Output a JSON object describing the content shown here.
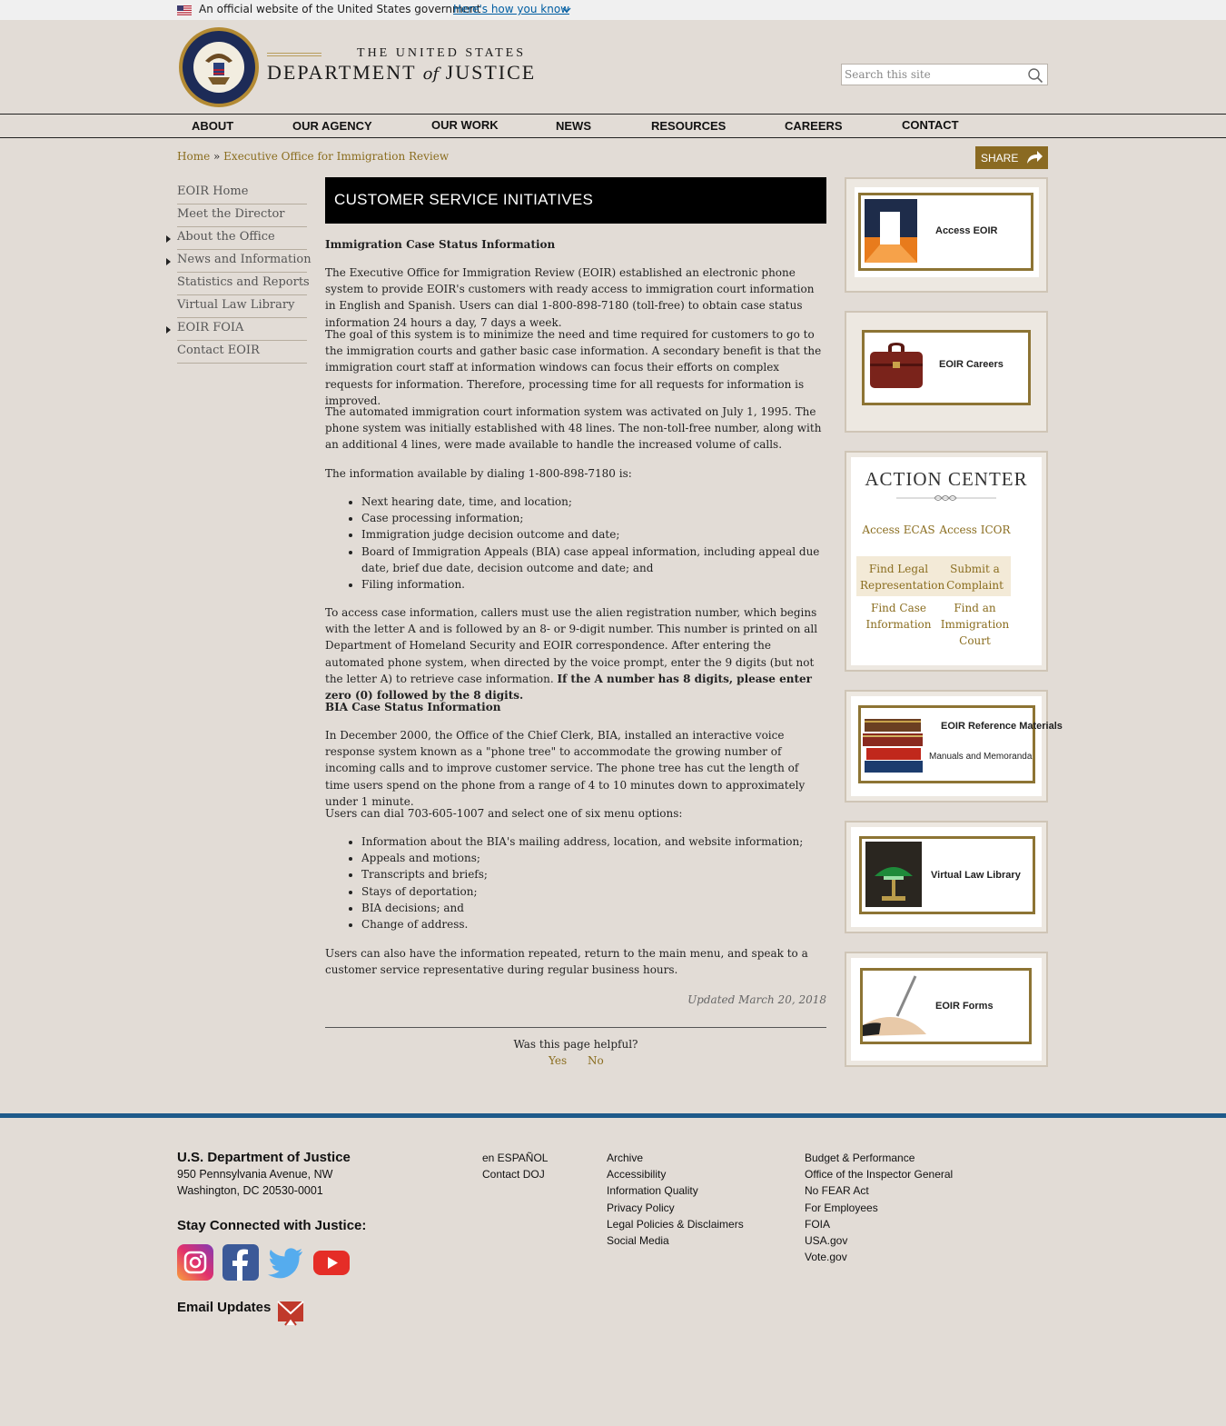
{
  "gov_banner": {
    "official_text": "An official website of the United States government",
    "how_you_know": "Here's how you know"
  },
  "header": {
    "title_line1": "THE UNITED STATES",
    "title_line2a": "DEPARTMENT",
    "title_line2b": "of",
    "title_line2c": "JUSTICE",
    "search_placeholder": "Search this site"
  },
  "nav": [
    "ABOUT",
    "OUR AGENCY",
    "OUR WORK",
    "NEWS",
    "RESOURCES",
    "CAREERS",
    "CONTACT"
  ],
  "breadcrumb": {
    "home": "Home",
    "sep": "»",
    "current": "Executive Office for Immigration Review"
  },
  "share_label": "SHARE",
  "left_nav": [
    {
      "label": "EOIR Home",
      "expandable": false
    },
    {
      "label": "Meet the Director",
      "expandable": false
    },
    {
      "label": "About the Office",
      "expandable": true
    },
    {
      "label": "News and Information",
      "expandable": true
    },
    {
      "label": "Statistics and Reports",
      "expandable": false
    },
    {
      "label": "Virtual Law Library",
      "expandable": false
    },
    {
      "label": "EOIR FOIA",
      "expandable": true
    },
    {
      "label": "Contact EOIR",
      "expandable": false
    }
  ],
  "main": {
    "heading": "CUSTOMER SERVICE INITIATIVES",
    "section1_title": "Immigration Case Status Information",
    "p1": "The Executive Office for Immigration Review (EOIR) established an electronic phone system to provide EOIR's customers with ready access to immigration court information in English and Spanish. Users can dial 1-800-898-7180 (toll-free) to obtain case status information 24 hours a day, 7 days a week.",
    "p2": "The goal of this system is to minimize the need and time required for customers to go to the immigration courts and gather basic case information. A secondary benefit is that the immigration court staff at information windows can focus their efforts on complex requests for information. Therefore, processing time for all requests for information is improved.",
    "p3": "The automated immigration court information system was activated on July 1, 1995. The phone system was initially established with 48 lines. The non-toll-free number, along with an additional 4 lines, were made available to handle the increased volume of calls.",
    "p4": "The information available by dialing 1-800-898-7180 is:",
    "list1": [
      "Next hearing date, time, and location;",
      "Case processing information;",
      "Immigration judge decision outcome and date;",
      "Board of Immigration Appeals (BIA) case appeal information, including appeal due date, brief due date, decision outcome and date; and",
      "Filing information."
    ],
    "p5": "To access case information, callers must use the alien registration number, which begins with the letter A and is followed by an 8- or 9-digit number. This number is printed on all Department of Homeland Security and EOIR correspondence. After entering the automated phone system, when directed by the voice prompt, enter the 9 digits (but not the letter A) to retrieve case information.",
    "p5_bold": "If the A number has 8 digits, please enter zero (0) followed by the 8 digits.",
    "section2_title": "BIA Case Status Information",
    "p6": "In December 2000, the Office of the Chief Clerk, BIA, installed an interactive voice response system known as a \"phone tree\" to accommodate the growing number of incoming calls and to improve customer service. The phone tree has cut the length of time users spend on the phone from a range of 4 to 10 minutes down to approximately under 1 minute.",
    "p7": "Users can dial 703-605-1007 and select one of six menu options:",
    "list2": [
      "Information about the BIA's mailing address, location, and website information;",
      "Appeals and motions;",
      "Transcripts and briefs;",
      "Stays of deportation;",
      "BIA decisions; and",
      "Change of address."
    ],
    "p8": "Users can also have the information repeated, return to the main menu, and speak to a customer service representative during regular business hours.",
    "updated": "Updated March 20, 2018",
    "helpful_q": "Was this page helpful?",
    "yes": "Yes",
    "no": "No"
  },
  "sidebar": {
    "access_eoir": "Access EOIR",
    "eoir_careers": "EOIR Careers",
    "action_center_title": "ACTION CENTER",
    "action_links": [
      "Access ECAS",
      "Access ICOR",
      "Find Legal Representation",
      "Submit a Complaint",
      "Find Case Information",
      "Find an Immigration Court"
    ],
    "ref_title": "EOIR Reference Materials",
    "ref_sub": "Manuals and Memoranda",
    "virtual_law": "Virtual Law Library",
    "eoir_forms": "EOIR Forms"
  },
  "footer": {
    "org": "U.S. Department of Justice",
    "addr1": "950 Pennsylvania Avenue, NW",
    "addr2": "Washington, DC 20530-0001",
    "stay_connected": "Stay Connected with Justice:",
    "email_updates": "Email Updates",
    "col1": [
      "en ESPAÑOL",
      "Contact DOJ"
    ],
    "col2": [
      "Archive",
      "Accessibility",
      "Information Quality",
      "Privacy Policy",
      "Legal Policies & Disclaimers",
      "Social Media"
    ],
    "col3": [
      "Budget & Performance",
      "Office of the Inspector General",
      "No FEAR Act",
      "For Employees",
      "FOIA",
      "USA.gov",
      "Vote.gov"
    ]
  },
  "colors": {
    "gold_link": "#8a6d1f",
    "banner_border": "#8d7434",
    "footer_bar": "#1e5a8a",
    "page_bg": "#e2dcd6"
  }
}
